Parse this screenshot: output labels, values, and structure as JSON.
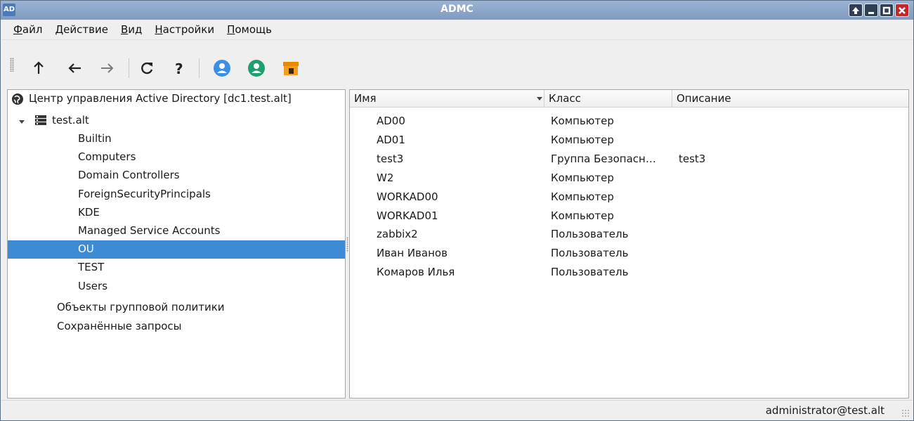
{
  "window": {
    "app_badge": "AD",
    "title": "ADMC",
    "controls": [
      "help-icon",
      "minimize-icon",
      "maximize-icon",
      "close-icon"
    ]
  },
  "menu": [
    {
      "underlined": "Ф",
      "rest": "айл"
    },
    {
      "underlined": "Д",
      "rest": "ействие"
    },
    {
      "underlined": "В",
      "rest": "ид"
    },
    {
      "underlined": "Н",
      "rest": "астройки"
    },
    {
      "underlined": "П",
      "rest": "омощь"
    }
  ],
  "toolbar": {
    "buttons": [
      "up-arrow-icon",
      "back-arrow-icon",
      "forward-arrow-icon",
      "refresh-icon",
      "help-icon",
      "new-user-icon",
      "new-group-icon",
      "new-ou-icon"
    ]
  },
  "tree": {
    "root_label": "Центр управления Active Directory [dc1.test.alt]",
    "domain_label": "test.alt",
    "items": [
      {
        "label": "Builtin",
        "icon": "builtin-icon",
        "expandable": true
      },
      {
        "label": "Computers",
        "icon": "folder-icon",
        "expandable": true
      },
      {
        "label": "Domain Controllers",
        "icon": "ou-icon",
        "expandable": true
      },
      {
        "label": "ForeignSecurityPrincipals",
        "icon": "folder-icon",
        "expandable": true
      },
      {
        "label": "KDE",
        "icon": "ou-icon",
        "expandable": true
      },
      {
        "label": "Managed Service Accounts",
        "icon": "folder-icon",
        "expandable": true
      },
      {
        "label": "OU",
        "icon": "ou-icon",
        "expandable": false,
        "selected": true
      },
      {
        "label": "TEST",
        "icon": "ou-icon",
        "expandable": true
      },
      {
        "label": "Users",
        "icon": "folder-icon",
        "expandable": true
      }
    ],
    "bottom_items": [
      {
        "label": "Объекты групповой политики",
        "icon": "folder-icon"
      },
      {
        "label": "Сохранённые запросы",
        "icon": "folder-icon"
      }
    ]
  },
  "list": {
    "columns": [
      "Имя",
      "Класс",
      "Описание"
    ],
    "sort_indicator": "sort-desc-icon",
    "rows": [
      {
        "name": "AD00",
        "class": "Компьютер",
        "description": "",
        "icon": "computer-icon"
      },
      {
        "name": "AD01",
        "class": "Компьютер",
        "description": "",
        "icon": "computer-icon"
      },
      {
        "name": "test3",
        "class": "Группа Безопасн…",
        "description": "test3",
        "icon": "group-icon"
      },
      {
        "name": "W2",
        "class": "Компьютер",
        "description": "",
        "icon": "computer-icon"
      },
      {
        "name": "WORKAD00",
        "class": "Компьютер",
        "description": "",
        "icon": "computer-icon"
      },
      {
        "name": "WORKAD01",
        "class": "Компьютер",
        "description": "",
        "icon": "computer-icon"
      },
      {
        "name": "zabbix2",
        "class": "Пользователь",
        "description": "",
        "icon": "disabled-user-icon"
      },
      {
        "name": "Иван Иванов",
        "class": "Пользователь",
        "description": "",
        "icon": "user-icon"
      },
      {
        "name": "Комаров Илья",
        "class": "Пользователь",
        "description": "",
        "icon": "user-icon"
      }
    ]
  },
  "status": {
    "user": "administrator@test.alt"
  },
  "colors": {
    "selection": "#3c8bd4",
    "user_icon": "#3d8fe6",
    "group_icon": "#1f9e6e",
    "folder": "#f39c1f"
  }
}
